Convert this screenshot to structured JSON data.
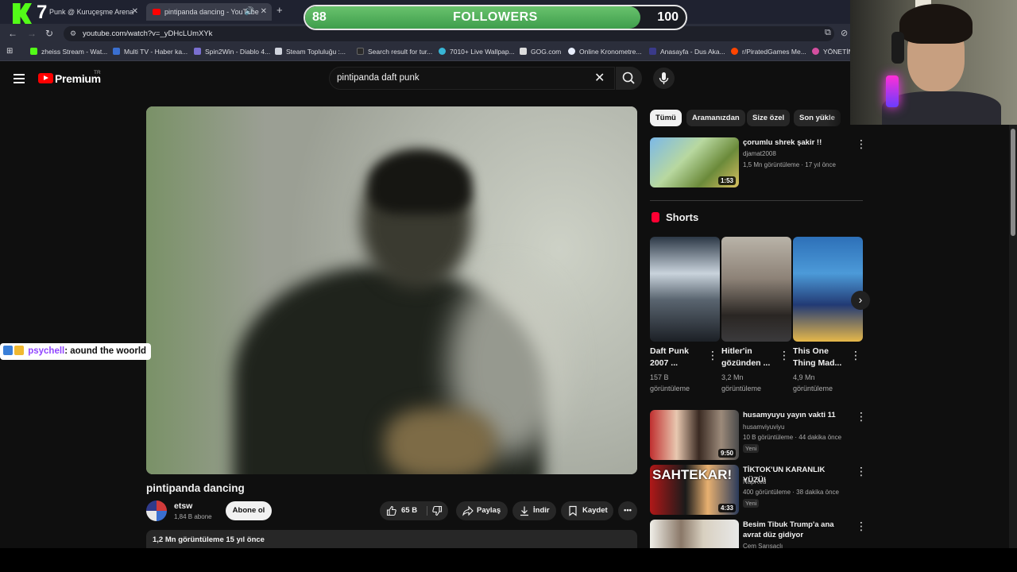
{
  "browser": {
    "tabs": [
      {
        "label": "Punk @ Kuruçeşme Arena"
      },
      {
        "label": "pintipanda dancing - YouTube"
      }
    ],
    "new_tab_symbol": "+",
    "close_symbol": "✕",
    "url": "youtube.com/watch?v=_yDHcLUmXYk",
    "bookmarks": [
      {
        "label": "zheiss Stream - Wat...",
        "color": "#53fc18"
      },
      {
        "label": "Multi TV - Haber ka...",
        "color": "#3a6fd0"
      },
      {
        "label": "Spin2Win - Diablo 4...",
        "color": "#7a6fd0"
      },
      {
        "label": "Steam Topluluğu :...",
        "color": "#cfd3dc"
      },
      {
        "label": "Search result for tur...",
        "color": "#2a2a2a"
      },
      {
        "label": "7010+ Live Wallpap...",
        "color": "#38b6d6"
      },
      {
        "label": "GOG.com",
        "color": "#dcdcdc"
      },
      {
        "label": "Online Kronometre...",
        "color": "#e8eefc"
      },
      {
        "label": "Anasayfa - Dus Aka...",
        "color": "#3a3a8a"
      },
      {
        "label": "r/PiratedGames Me...",
        "color": "#ff4500"
      },
      {
        "label": "YÖNETİM",
        "color": "#d44fa0"
      }
    ]
  },
  "overlay": {
    "followers_current": "88",
    "followers_label": "FOLLOWERS",
    "followers_goal": "100",
    "followers_fraction": 0.88,
    "kick_number": "7",
    "chat": {
      "user": "psychell",
      "message": ": aound the woorld"
    }
  },
  "youtube": {
    "logo_text": "Premium",
    "country_code": "TR",
    "search_query": "pintipanda daft punk",
    "video": {
      "title": "pintipanda dancing",
      "channel": "etsw",
      "subscribers": "1,84 B abone",
      "subscribe_label": "Abone ol",
      "likes": "65 B",
      "share_label": "Paylaş",
      "download_label": "İndir",
      "save_label": "Kaydet",
      "views_date": "1,2 Mn görüntüleme  15 yıl önce"
    },
    "chips": [
      "Tümü",
      "Aramanızdan",
      "Size özel",
      "Son yükle"
    ],
    "side_videos": [
      {
        "title": "çorumlu shrek şakir !!",
        "channel": "djamat2008",
        "meta": "1,5 Mn görüntüleme · 17 yıl önce",
        "duration": "1:53"
      },
      {
        "title": "husamyuyu yayın vakti 11",
        "channel": "husamviyuviyu",
        "meta": "10 B görüntüleme · 44 dakika önce",
        "badge": "Yeni",
        "duration": "9:50"
      },
      {
        "title": "TİKTOK'UN KARANLIK YÜZÜ!",
        "channel": "NapRed",
        "meta": "400 görüntüleme · 38 dakika önce",
        "badge": "Yeni",
        "duration": "4:33"
      },
      {
        "title": "Besim Tibuk Trump'a ana avrat düz gidiyor",
        "channel": "Cem Sarısaçlı"
      }
    ],
    "shorts_heading": "Shorts",
    "shorts": [
      {
        "title": "Daft Punk 2007 ...",
        "views": "157 B görüntüleme"
      },
      {
        "title": "Hitler'in gözünden ...",
        "views": "3,2 Mn görüntüleme"
      },
      {
        "title": "This One Thing Mad...",
        "views": "4,9 Mn görüntüleme"
      }
    ]
  }
}
